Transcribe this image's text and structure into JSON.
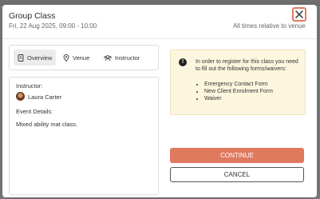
{
  "modal": {
    "title": "Group Class",
    "subtitle": "Fri, 22 Aug 2025, 09:00 - 10:00",
    "timezone_note": "All times relative to venue",
    "close_icon": "close-icon"
  },
  "tabs": [
    {
      "label": "Overview",
      "icon": "document-icon",
      "active": true
    },
    {
      "label": "Venue",
      "icon": "location-pin-icon",
      "active": false
    },
    {
      "label": "Instructor",
      "icon": "group-icon",
      "active": false
    }
  ],
  "details": {
    "instructor_label": "Instructor:",
    "instructor_name": "Laura Carter",
    "event_details_label": "Event Details:",
    "event_description": "Mixed ability mat class."
  },
  "notice": {
    "icon": "info-icon",
    "text": "In order to register for this class you need to fill out the following forms/waivers:",
    "forms": [
      "Emergency Contact Form",
      "New Client Enrolment Form",
      "Waiver"
    ]
  },
  "actions": {
    "continue_label": "CONTINUE",
    "cancel_label": "CANCEL"
  },
  "colors": {
    "accent": "#e07a5f",
    "notice_bg": "#fdf6df"
  }
}
